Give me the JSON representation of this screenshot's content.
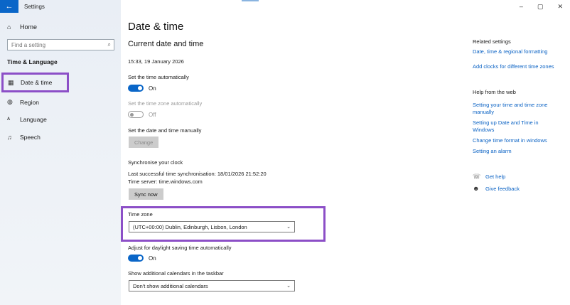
{
  "window": {
    "app_title": "Settings",
    "back_icon": "←",
    "minimize_icon": "–",
    "restore_icon": "▢",
    "close_icon": "✕"
  },
  "sidebar": {
    "home_label": "Home",
    "search_placeholder": "Find a setting",
    "section_title": "Time & Language",
    "items": [
      {
        "label": "Date & time",
        "icon": "calendar-clock-icon"
      },
      {
        "label": "Region",
        "icon": "globe-icon"
      },
      {
        "label": "Language",
        "icon": "language-icon"
      },
      {
        "label": "Speech",
        "icon": "microphone-icon"
      }
    ]
  },
  "main": {
    "title": "Date & time",
    "current_heading": "Current date and time",
    "current_value": "15:33, 19 January 2026",
    "auto_time_label": "Set the time automatically",
    "auto_time_state": "On",
    "auto_tz_label": "Set the time zone automatically",
    "auto_tz_state": "Off",
    "manual_label": "Set the date and time manually",
    "change_button": "Change",
    "sync_heading": "Synchronise your clock",
    "sync_last": "Last successful time synchronisation: 18/01/2026 21:52:20",
    "sync_server": "Time server: time.windows.com",
    "sync_button": "Sync now",
    "timezone_label": "Time zone",
    "timezone_value": "(UTC+00:00) Dublin, Edinburgh, Lisbon, London",
    "dst_label": "Adjust for daylight saving time automatically",
    "dst_state": "On",
    "calendars_label": "Show additional calendars in the taskbar",
    "calendars_value": "Don't show additional calendars"
  },
  "right_panel": {
    "related_title": "Related settings",
    "related_links": [
      "Date, time & regional formatting",
      "Add clocks for different time zones"
    ],
    "help_title": "Help from the web",
    "help_links": [
      "Setting your time and time zone manually",
      "Setting up Date and Time in Windows",
      "Change time format in windows",
      "Setting an alarm"
    ],
    "get_help": "Get help",
    "give_feedback": "Give feedback"
  },
  "colors": {
    "accent": "#0a66c8",
    "highlight": "#8c4fc7",
    "link": "#0a62c4"
  }
}
